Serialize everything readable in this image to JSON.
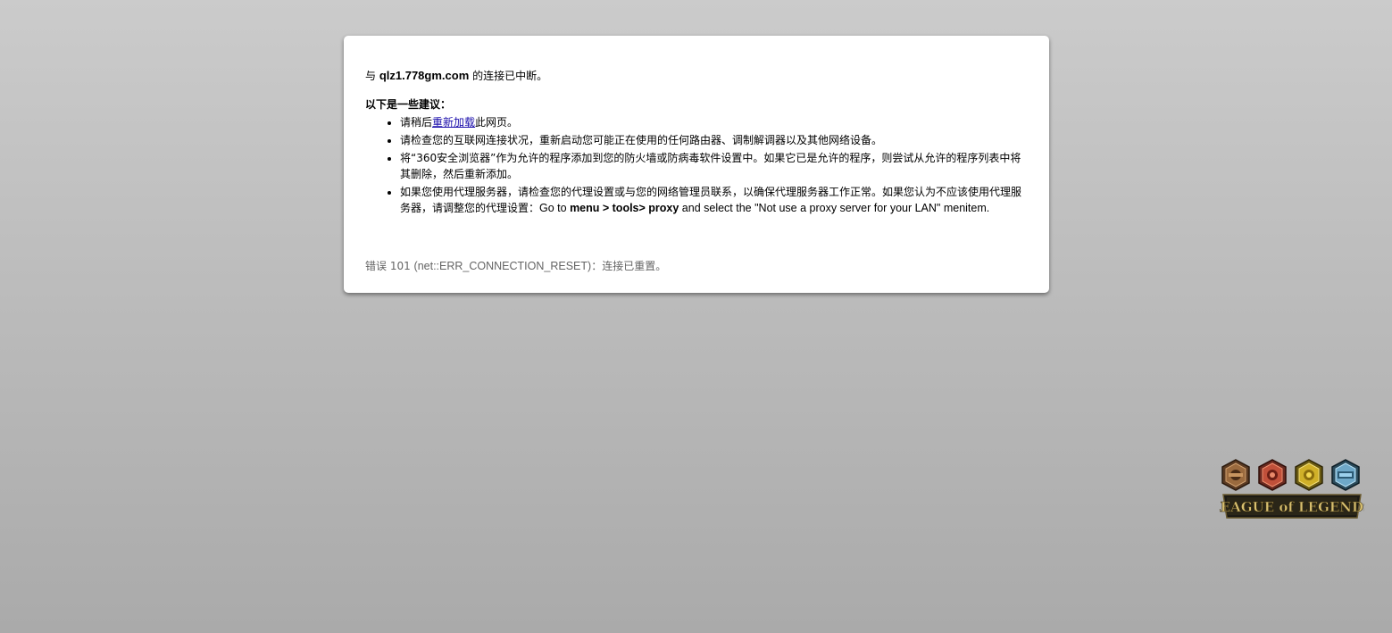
{
  "error": {
    "headline_prefix": "与 ",
    "host": "qlz1.778gm.com",
    "headline_suffix": " 的连接已中断。",
    "suggestions_title": "以下是一些建议：",
    "suggestions": [
      {
        "before": "请稍后",
        "link": "重新加载",
        "after": "此网页。"
      },
      {
        "text": "请检查您的互联网连接状况，重新启动您可能正在使用的任何路由器、调制解调器以及其他网络设备。"
      },
      {
        "text": "将“360安全浏览器”作为允许的程序添加到您的防火墙或防病毒软件设置中。如果它已是允许的程序，则尝试从允许的程序列表中将其删除，然后重新添加。"
      },
      {
        "text_cn": "如果您使用代理服务器，请检查您的代理设置或与您的网络管理员联系，以确保代理服务器工作正常。如果您认为不应该使用代理服务器，请调整您的代理设置：",
        "go_to": "Go to ",
        "menu_path": "menu > tools> proxy",
        "select_text": " and select the \"Not use a proxy server for your LAN\" menitem."
      }
    ],
    "code_prefix": "错误 101 ",
    "code_value": "(net::ERR_CONNECTION_RESET)",
    "code_suffix": "：连接已重置。"
  },
  "logo": {
    "text": "LEAGUE of LEGENDS",
    "icon_names": [
      "lol-crest-bronze-icon",
      "lol-crest-red-icon",
      "lol-crest-gold-icon",
      "lol-crest-blue-icon"
    ]
  },
  "colors": {
    "link": "#1a0dab",
    "error_code": "#646464",
    "card": "#ffffff"
  }
}
